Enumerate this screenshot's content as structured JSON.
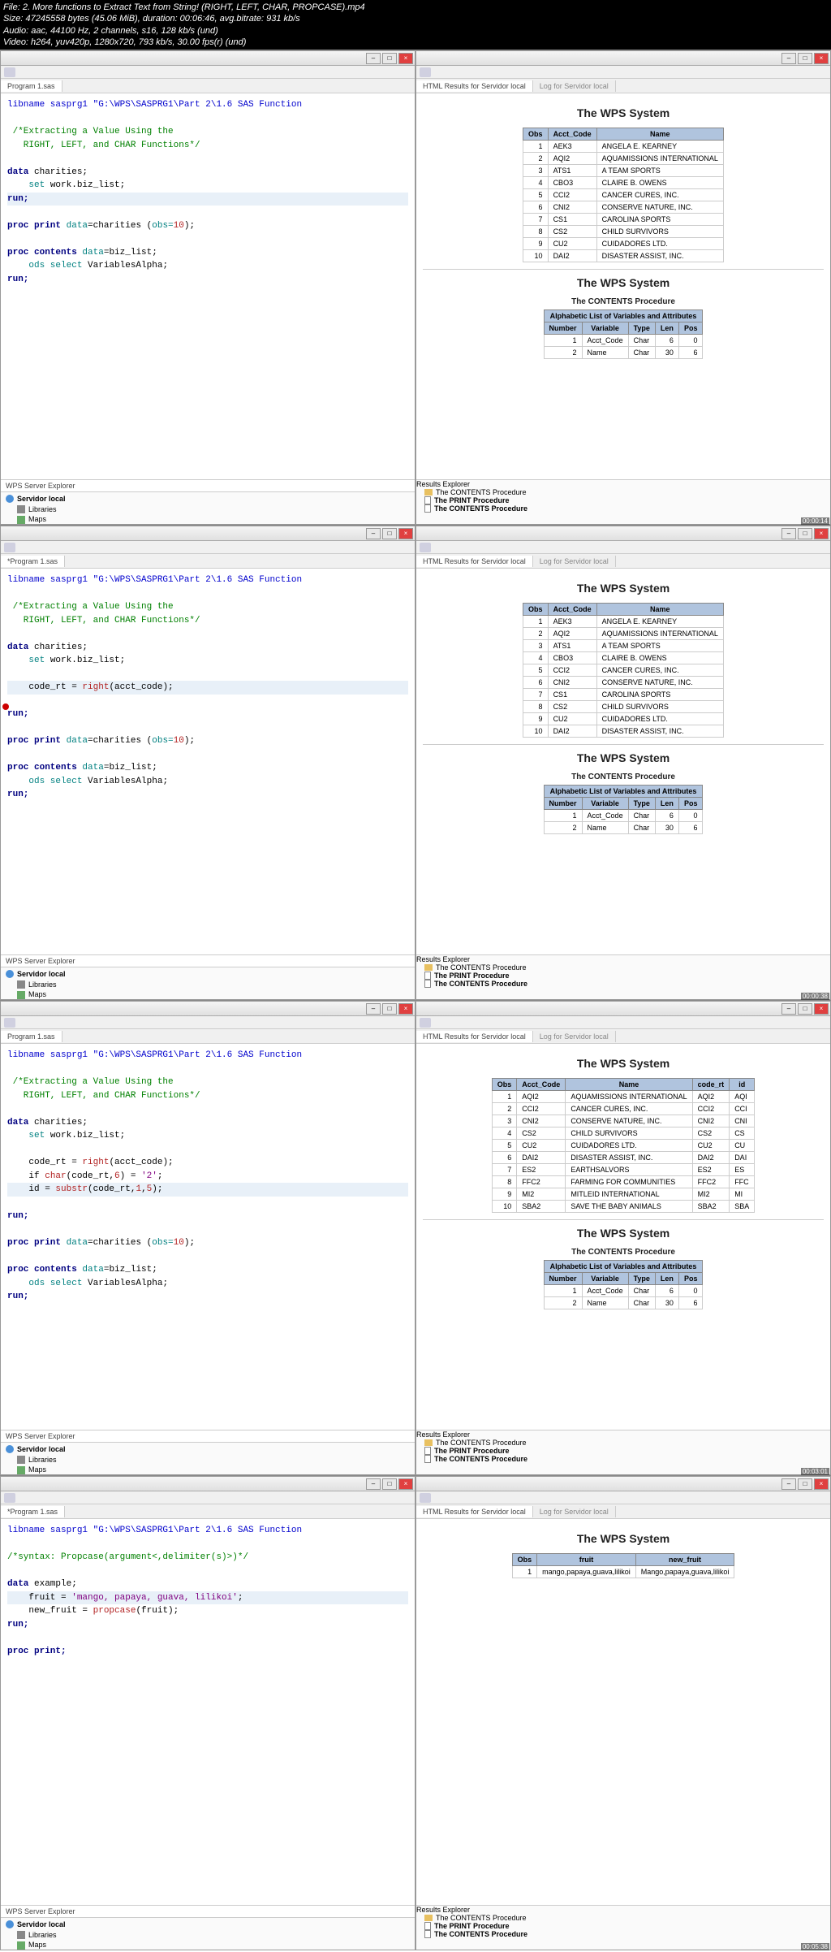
{
  "header": {
    "file": "File: 2. More functions to Extract Text from String! (RIGHT, LEFT, CHAR, PROPCASE).mp4",
    "size": "Size: 47245558 bytes (45.06 MiB), duration: 00:06:46, avg.bitrate: 931 kb/s",
    "audio": "Audio: aac, 44100 Hz, 2 channels, s16, 128 kb/s (und)",
    "video": "Video: h264, yuv420p, 1280x720, 793 kb/s, 30.00 fps(r) (und)"
  },
  "tabs": {
    "program": "Program 1.sas",
    "program_star": "*Program 1.sas",
    "html_results": "HTML Results for Servidor local",
    "log": "Log for Servidor local",
    "wps_explorer": "WPS Server Explorer",
    "results_explorer": "Results Explorer"
  },
  "explorer_tree": {
    "server": "Servidor local",
    "libraries": "Libraries",
    "maps": "Maps"
  },
  "results_tree": {
    "contents": "The CONTENTS Procedure",
    "print": "The PRINT Procedure",
    "contents2": "The CONTENTS Procedure"
  },
  "wps_title": "The WPS System",
  "contents_subtitle": "The CONTENTS Procedure",
  "attrs_caption": "Alphabetic List of Variables and Attributes",
  "table1_headers": [
    "Obs",
    "Acct_Code",
    "Name"
  ],
  "table1_rows": [
    [
      "1",
      "AEK3",
      "ANGELA E. KEARNEY"
    ],
    [
      "2",
      "AQI2",
      "AQUAMISSIONS INTERNATIONAL"
    ],
    [
      "3",
      "ATS1",
      "A TEAM SPORTS"
    ],
    [
      "4",
      "CBO3",
      "CLAIRE B. OWENS"
    ],
    [
      "5",
      "CCI2",
      "CANCER CURES, INC."
    ],
    [
      "6",
      "CNI2",
      "CONSERVE NATURE, INC."
    ],
    [
      "7",
      "CS1",
      "CAROLINA SPORTS"
    ],
    [
      "8",
      "CS2",
      "CHILD SURVIVORS"
    ],
    [
      "9",
      "CU2",
      "CUIDADORES LTD."
    ],
    [
      "10",
      "DAI2",
      "DISASTER ASSIST, INC."
    ]
  ],
  "attrs_headers": [
    "Number",
    "Variable",
    "Type",
    "Len",
    "Pos"
  ],
  "attrs_rows": [
    [
      "1",
      "Acct_Code",
      "Char",
      "6",
      "0"
    ],
    [
      "2",
      "Name",
      "Char",
      "30",
      "6"
    ]
  ],
  "table3_headers": [
    "Obs",
    "Acct_Code",
    "Name",
    "code_rt",
    "id"
  ],
  "table3_rows": [
    [
      "1",
      "AQI2",
      "AQUAMISSIONS INTERNATIONAL",
      "AQI2",
      "AQI"
    ],
    [
      "2",
      "CCI2",
      "CANCER CURES, INC.",
      "CCI2",
      "CCI"
    ],
    [
      "3",
      "CNI2",
      "CONSERVE NATURE, INC.",
      "CNI2",
      "CNI"
    ],
    [
      "4",
      "CS2",
      "CHILD SURVIVORS",
      "CS2",
      "CS"
    ],
    [
      "5",
      "CU2",
      "CUIDADORES LTD.",
      "CU2",
      "CU"
    ],
    [
      "6",
      "DAI2",
      "DISASTER ASSIST, INC.",
      "DAI2",
      "DAI"
    ],
    [
      "7",
      "ES2",
      "EARTHSALVORS",
      "ES2",
      "ES"
    ],
    [
      "8",
      "FFC2",
      "FARMING FOR COMMUNITIES",
      "FFC2",
      "FFC"
    ],
    [
      "9",
      "MI2",
      "MITLEID INTERNATIONAL",
      "MI2",
      "MI"
    ],
    [
      "10",
      "SBA2",
      "SAVE THE BABY ANIMALS",
      "SBA2",
      "SBA"
    ]
  ],
  "table4_headers": [
    "Obs",
    "fruit",
    "new_fruit"
  ],
  "table4_rows": [
    [
      "1",
      "mango,papaya,guava,lilikoi",
      "Mango,papaya,guava,lilikoi"
    ]
  ],
  "code1": {
    "l1": "libname sasprg1 \"G:\\WPS\\SASPRG1\\Part 2\\1.6 SAS Function",
    "c1": " /*Extracting a Value Using the",
    "c2": "   RIGHT, LEFT, and CHAR Functions*/",
    "l3a": "data",
    "l3b": " charities;",
    "l4a": "    set",
    "l4b": " work.biz_list;",
    "l5": "run;",
    "l6a": "proc print",
    "l6b": " data",
    "l6c": "=charities (",
    "l6d": "obs=",
    "l6e": "10",
    "l6f": ");",
    "l7a": "proc contents",
    "l7b": " data",
    "l7c": "=biz_list;",
    "l8a": "    ods select",
    "l8b": " VariablesAlpha;",
    "l9": "run;"
  },
  "code2": {
    "l5a": "    code_rt = ",
    "l5b": "right",
    "l5c": "(acct_code);"
  },
  "code3": {
    "l5a": "    code_rt = ",
    "l5b": "right",
    "l5c": "(acct_code);",
    "l6a": "    if ",
    "l6b": "char",
    "l6c": "(code_rt,",
    "l6d": "6",
    "l6e": ") = ",
    "l6f": "'2'",
    "l6g": ";",
    "l7a": "    id = ",
    "l7b": "substr",
    "l7c": "(code_rt,",
    "l7d": "1",
    "l7e": ",",
    "l7f": "5",
    "l7g": ");"
  },
  "code4": {
    "c1": "/*syntax: Propcase(argument<,delimiter(s)>)*/",
    "l2a": "data",
    "l2b": " example;",
    "l3a": "    fruit = ",
    "l3b": "'mango, papaya, guava, lilikoi'",
    "l3c": ";",
    "l4a": "    new_fruit = ",
    "l4b": "propcase",
    "l4c": "(fruit);",
    "l5": "run;",
    "l6": "proc print;"
  },
  "timestamps": [
    "00:00:14",
    "00:00:38",
    "00:03:01",
    "00:05:38"
  ]
}
